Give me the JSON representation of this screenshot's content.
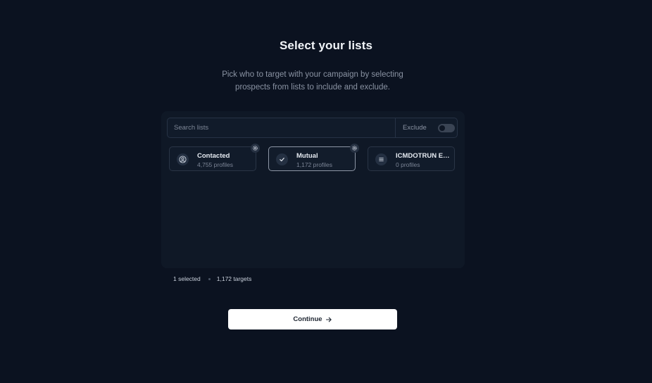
{
  "header": {
    "title": "Select your lists",
    "subtitle": "Pick who to target with your campaign by selecting prospects from lists to include and exclude."
  },
  "search": {
    "placeholder": "Search lists",
    "value": ""
  },
  "exclude": {
    "label": "Exclude",
    "enabled": false
  },
  "lists": [
    {
      "name": "Contacted",
      "count": "4,755 profiles",
      "icon": "user-circle-icon",
      "selected": false
    },
    {
      "name": "Mutual",
      "count": "1,172 profiles",
      "icon": "check-icon",
      "selected": true
    },
    {
      "name": "ICMDOTRUN E…",
      "count": "0 profiles",
      "icon": "list-icon",
      "selected": false
    }
  ],
  "summary": {
    "selected": "1 selected",
    "targets": "1,172 targets"
  },
  "actions": {
    "continue_label": "Continue"
  },
  "colors": {
    "background": "#0b1220",
    "panel": "#0f1826",
    "button": "#ffffff"
  }
}
